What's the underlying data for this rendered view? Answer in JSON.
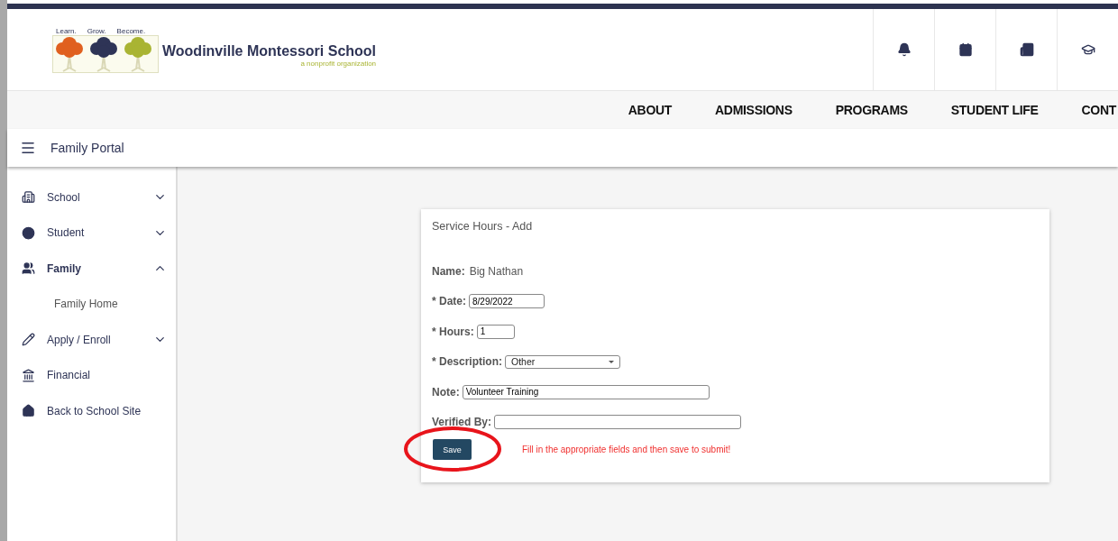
{
  "logo": {
    "taglines": [
      "Learn.",
      "Grow.",
      "Become."
    ],
    "name": "Woodinville Montessori School",
    "subtitle": "a nonprofit organization"
  },
  "nav": [
    "ABOUT",
    "ADMISSIONS",
    "PROGRAMS",
    "STUDENT LIFE",
    "CONT"
  ],
  "portal_bar": {
    "title": "Family Portal"
  },
  "sidebar": {
    "items": [
      {
        "label": "School",
        "expanded": false,
        "selected": false
      },
      {
        "label": "Student",
        "expanded": false,
        "selected": false
      },
      {
        "label": "Family",
        "expanded": true,
        "selected": true,
        "children": [
          {
            "label": "Family Home"
          }
        ]
      },
      {
        "label": "Apply / Enroll",
        "expanded": false,
        "selected": false
      },
      {
        "label": "Financial",
        "selected": false
      },
      {
        "label": "Back to School Site",
        "selected": false
      }
    ]
  },
  "form": {
    "title": "Service Hours - Add",
    "name": {
      "label": "Name:",
      "value": "Big Nathan"
    },
    "fields": [
      {
        "kind": "date",
        "label": "* Date:",
        "value": "8/29/2022"
      },
      {
        "kind": "number",
        "label": "* Hours:",
        "value": "1"
      },
      {
        "kind": "select",
        "label": "* Description:",
        "value": "Other"
      },
      {
        "kind": "text",
        "label": "Note:",
        "value": "Volunteer Training"
      },
      {
        "kind": "text",
        "label": "Verified By:"
      }
    ],
    "save_button": {
      "label": "Save",
      "circled": true
    },
    "hint": "Fill in the appropriate fields and then save to submit!"
  }
}
